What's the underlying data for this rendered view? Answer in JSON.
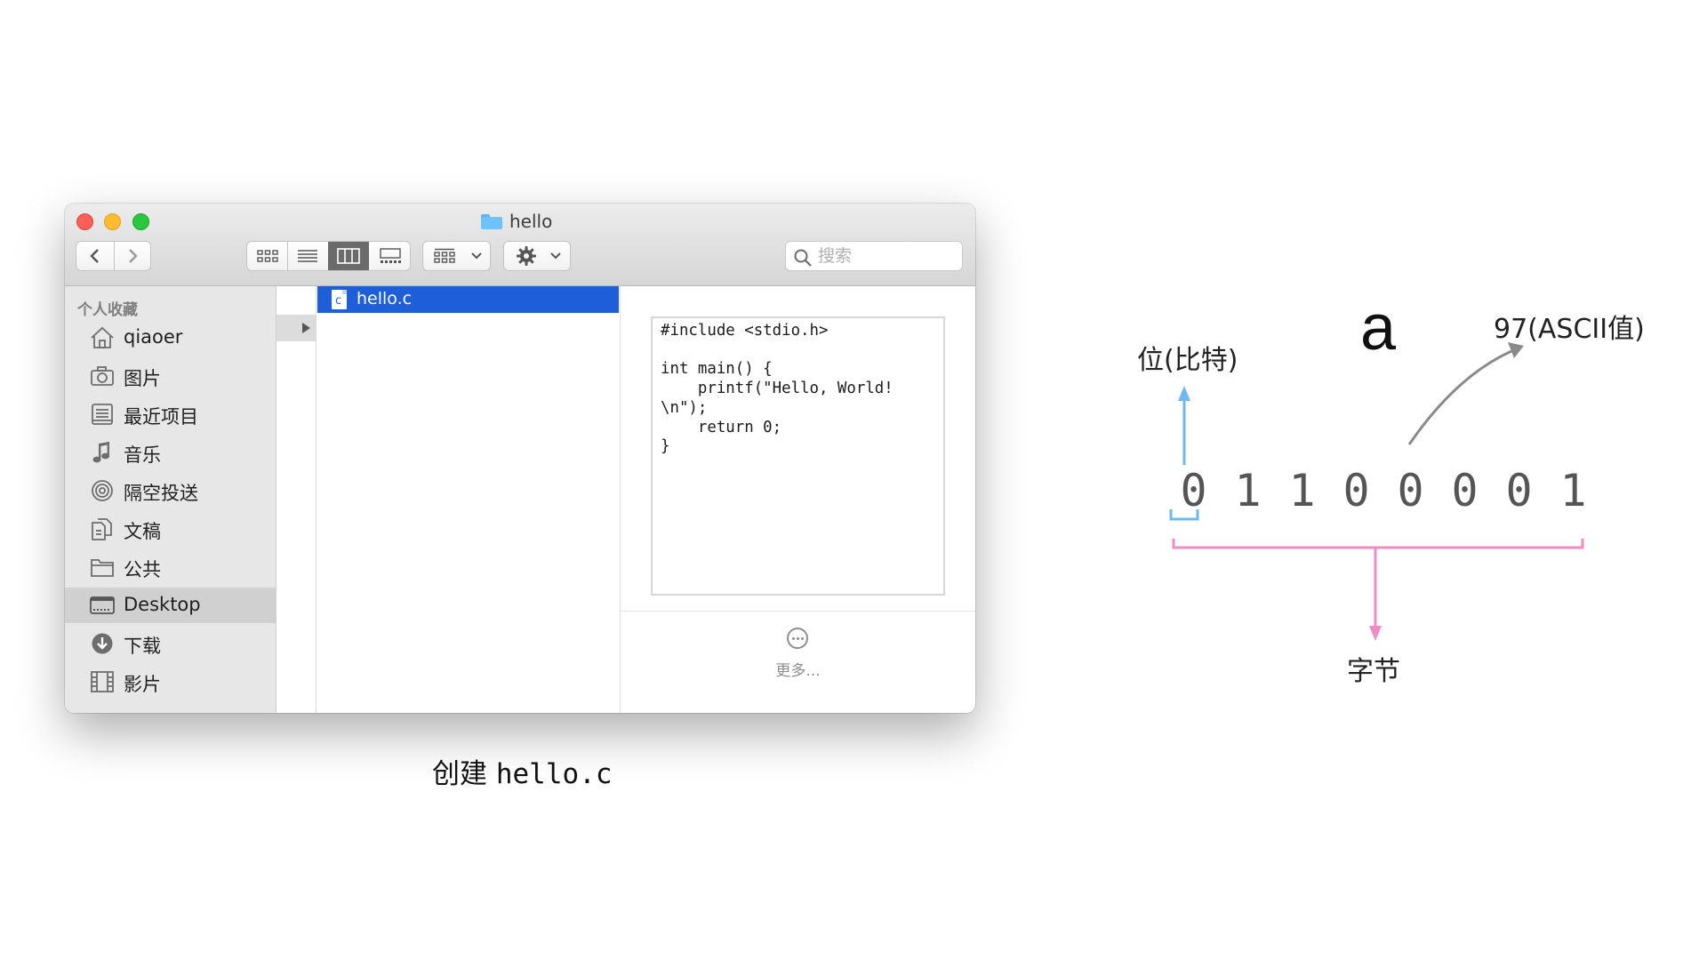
{
  "finder": {
    "window_title": "hello",
    "search_placeholder": "搜索",
    "sidebar": {
      "heading": "个人收藏",
      "items": [
        {
          "label": "qiaoer",
          "icon": "home-icon"
        },
        {
          "label": "图片",
          "icon": "camera-icon"
        },
        {
          "label": "最近项目",
          "icon": "recents-icon"
        },
        {
          "label": "音乐",
          "icon": "music-note-icon"
        },
        {
          "label": "隔空投送",
          "icon": "airdrop-icon"
        },
        {
          "label": "文稿",
          "icon": "documents-icon"
        },
        {
          "label": "公共",
          "icon": "folder-icon"
        },
        {
          "label": "Desktop",
          "icon": "desktop-icon",
          "selected": true
        },
        {
          "label": "下载",
          "icon": "download-icon"
        },
        {
          "label": "影片",
          "icon": "film-icon"
        }
      ]
    },
    "selected_file": {
      "name": "hello.c",
      "icon_letter": "c"
    },
    "preview": {
      "code": "#include <stdio.h>\n\nint main() {\n    printf(\"Hello, World!\n\\n\");\n    return 0;\n}",
      "more_label": "更多..."
    }
  },
  "caption": {
    "cjk": "创建",
    "code": "hello.c"
  },
  "diagram": {
    "letter": "a",
    "ascii_label": "97(ASCII值)",
    "bit_label": "位(比特)",
    "byte_label": "字节",
    "bits": [
      "0",
      "1",
      "1",
      "0",
      "0",
      "0",
      "0",
      "1"
    ],
    "colors": {
      "bit_arrow": "#6fb8ee",
      "byte_bracket": "#ee8cc3",
      "ascii_arrow": "#8a8a8a"
    }
  }
}
